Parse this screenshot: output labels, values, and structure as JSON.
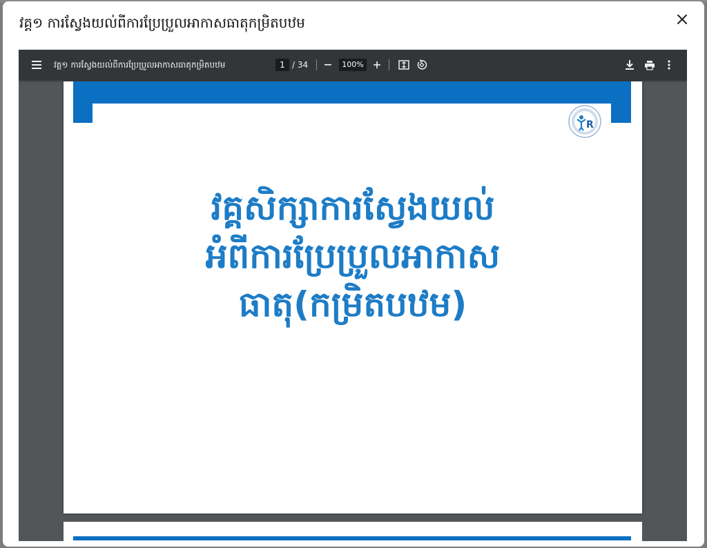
{
  "modal": {
    "title": "វគ្គ១ ការស្វែងយល់ពីការប្រែប្រួលអាកាសធាតុកម្រិតបឋម",
    "close_icon": "close-icon"
  },
  "viewer": {
    "toolbar": {
      "menu_icon": "hamburger-menu-icon",
      "doc_name": "វគ្គ១ ការស្វែងយល់ពីការប្រែប្រួលអាកាសធាតុកម្រិតបឋម",
      "page_current": "1",
      "page_total": "/ 34",
      "zoom_value": "100%",
      "icons": [
        "zoom-out-icon",
        "zoom-in-icon",
        "fit-page-icon",
        "rotate-icon",
        "download-icon",
        "print-icon",
        "more-options-icon"
      ]
    },
    "page1": {
      "title_lines": [
        "វគ្គសិក្សាការស្វែងយល់",
        "អំពីការប្រែប្រួលអាកាស",
        "ធាតុ(កម្រិតបឋម)"
      ],
      "accent_color": "#0b6fc2",
      "title_color": "#1d7cc6"
    }
  }
}
